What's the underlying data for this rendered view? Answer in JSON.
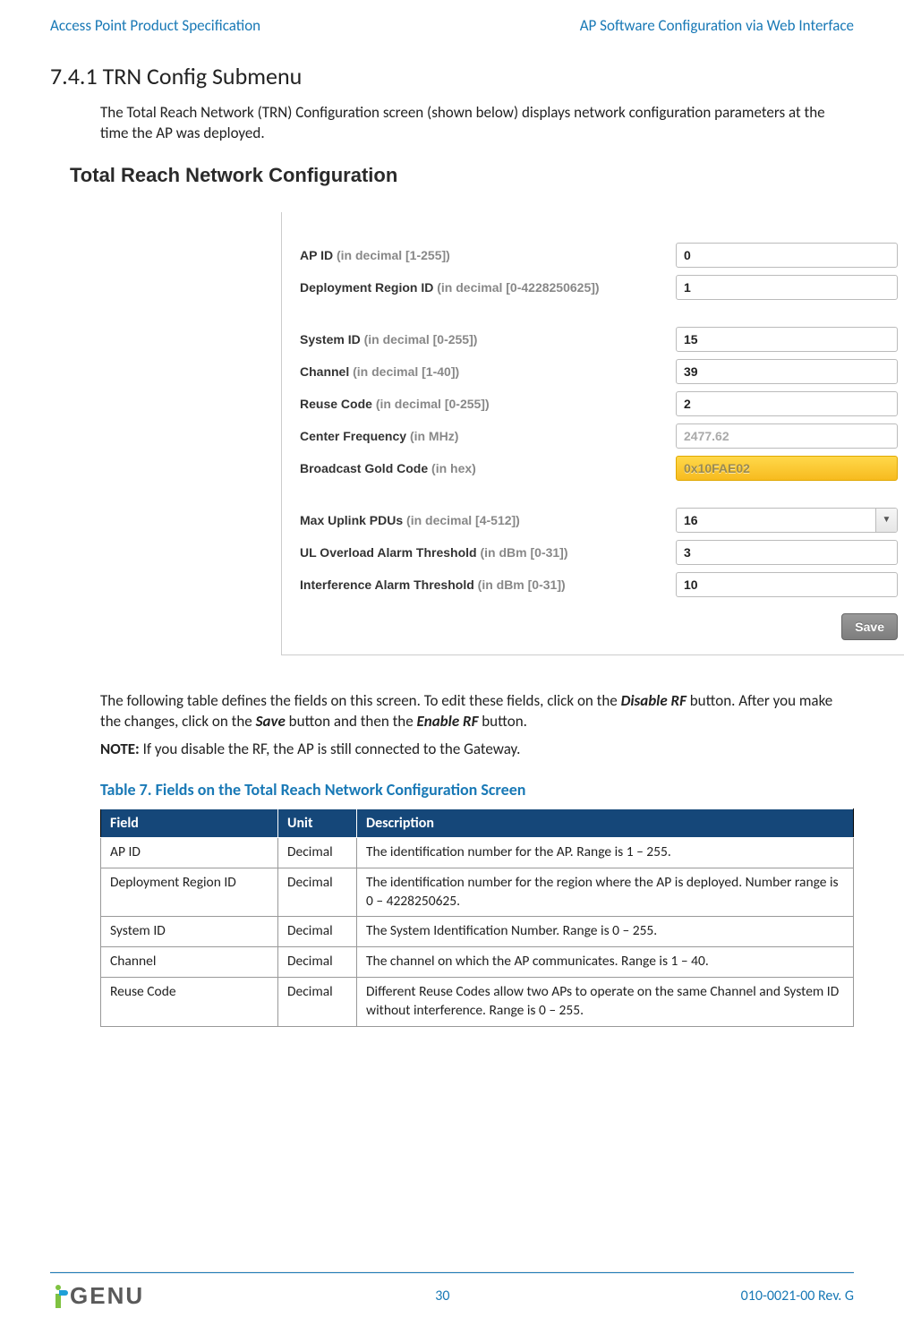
{
  "header": {
    "left": "Access Point Product Specification",
    "right": "AP Software Configuration via Web Interface"
  },
  "section": {
    "number": "7.4.1",
    "title": "TRN Config Submenu"
  },
  "intro": "The Total Reach Network (TRN) Configuration screen (shown below) displays network configuration parameters at the time the AP was deployed.",
  "screenshot": {
    "title": "Total Reach Network Configuration",
    "rows": [
      {
        "label": "AP ID",
        "hint": "(in decimal [1-255])",
        "value": "0",
        "type": "input"
      },
      {
        "label": "Deployment Region ID",
        "hint": "(in decimal [0-4228250625])",
        "value": "1",
        "type": "input"
      },
      {
        "label": "System ID",
        "hint": "(in decimal [0-255])",
        "value": "15",
        "type": "input",
        "gap": true
      },
      {
        "label": "Channel",
        "hint": "(in decimal [1-40])",
        "value": "39",
        "type": "input"
      },
      {
        "label": "Reuse Code",
        "hint": "(in decimal [0-255])",
        "value": "2",
        "type": "input"
      },
      {
        "label": "Center Frequency",
        "hint": "(in MHz)",
        "value": "2477.62",
        "type": "readonly"
      },
      {
        "label": "Broadcast Gold Code",
        "hint": "(in hex)",
        "value": "0x10FAE02",
        "type": "gold"
      },
      {
        "label": "Max Uplink PDUs",
        "hint": "(in decimal [4-512])",
        "value": "16",
        "type": "select",
        "gap": true
      },
      {
        "label": "UL Overload Alarm Threshold",
        "hint": "(in dBm [0-31])",
        "value": "3",
        "type": "input"
      },
      {
        "label": "Interference Alarm Threshold",
        "hint": "(in dBm [0-31])",
        "value": "10",
        "type": "input"
      }
    ],
    "save_label": "Save"
  },
  "para2a": "The following table defines the fields on this screen. To edit these fields, click on the ",
  "para2b": "Disable RF",
  "para2c": " button. After you make the changes, click on the ",
  "para2d": "Save",
  "para2e": " button and then the ",
  "para2f": "Enable RF",
  "para2g": " button.",
  "note_label": "NOTE:",
  "note_text": "  If you disable the RF, the AP is still connected to the Gateway.",
  "table_caption": "Table 7. Fields on the Total Reach Network Configuration Screen",
  "table": {
    "headers": [
      "Field",
      "Unit",
      "Description"
    ],
    "rows": [
      [
        "AP ID",
        "Decimal",
        "The identification number for the AP. Range is 1 – 255."
      ],
      [
        "Deployment Region ID",
        "Decimal",
        "The identification number for the region where the AP is deployed. Number range is 0 – 4228250625."
      ],
      [
        "System ID",
        "Decimal",
        "The System Identification Number. Range is 0 – 255."
      ],
      [
        "Channel",
        "Decimal",
        "The channel on which the AP communicates. Range is 1 – 40."
      ],
      [
        "Reuse Code",
        "Decimal",
        "Different Reuse Codes allow two APs to operate on the same Channel and System ID without interference. Range is 0 – 255."
      ]
    ]
  },
  "footer": {
    "page": "30",
    "rev": "010-0021-00 Rev. G",
    "logo_text": "GENU"
  }
}
